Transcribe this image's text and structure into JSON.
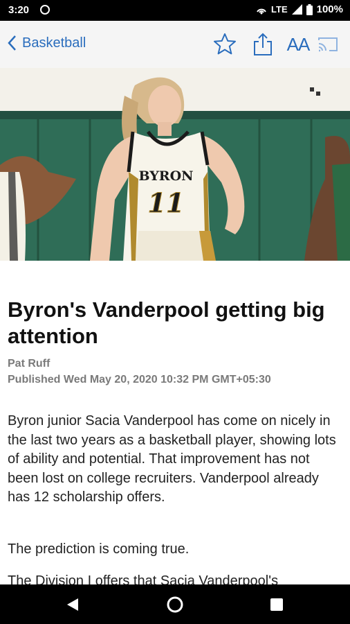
{
  "status_bar": {
    "time": "3:20",
    "network": "LTE",
    "battery": "100%"
  },
  "toolbar": {
    "back_label": "Basketball",
    "font_size_label": "AA",
    "accent_color": "#2a6dbd"
  },
  "hero_image": {
    "jersey_name": "BYRON",
    "jersey_number": "11"
  },
  "article": {
    "headline": "Byron's Vanderpool getting big attention",
    "author": "Pat Ruff",
    "published": "Published Wed May 20, 2020 10:32 PM GMT+05:30",
    "paragraphs": [
      "Byron junior Sacia Vanderpool has come on nicely in the last two years as a basketball player, showing lots of ability and potential. That improvement has not been lost on college recruiters. Vanderpool already has 12 scholarship offers.",
      "The prediction is coming true.",
      "The Division I offers that Sacia Vanderpool's"
    ]
  }
}
